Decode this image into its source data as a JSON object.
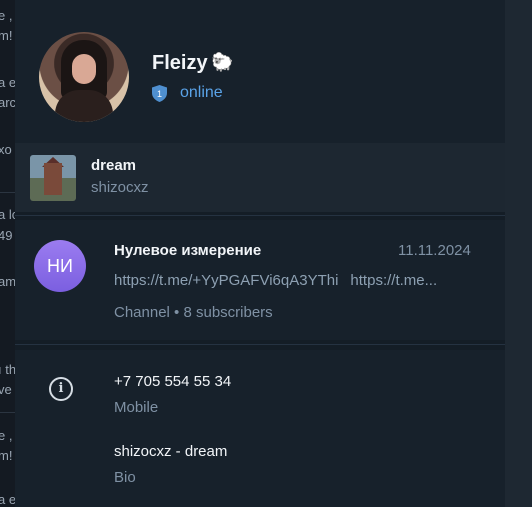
{
  "background_chat": {
    "fragments": [
      "e ,",
      "m!",
      "a e",
      "arc",
      "xo",
      "a lc",
      "49",
      "am",
      "ı th",
      "ve",
      "e ,",
      "m!",
      "a e"
    ]
  },
  "profile": {
    "name": "Fleizy",
    "name_emoji": "🐑",
    "badge_count": "1",
    "status": "online",
    "avatar_icon": "profile-photo"
  },
  "personal_channel": {
    "title": "dream",
    "username": "shizocxz"
  },
  "linked_channel": {
    "avatar_initials": "НИ",
    "title": "Нулевое измерение",
    "date": "11.11.2024",
    "message_part1": "https://t.me/+YyPGAFVi6qA3YThi",
    "message_part2": "https://t.me...",
    "meta": "Channel • 8 subscribers"
  },
  "info": {
    "phone": "+7 705 554 55 34",
    "phone_label": "Mobile",
    "bio": "shizocxz - dream",
    "bio_label": "Bio",
    "icon": "info-icon"
  },
  "colors": {
    "panel_bg": "#17212b",
    "accent": "#5aa3e8",
    "secondary_text": "#7f91a4",
    "channel_avatar": "#8a6cec"
  }
}
